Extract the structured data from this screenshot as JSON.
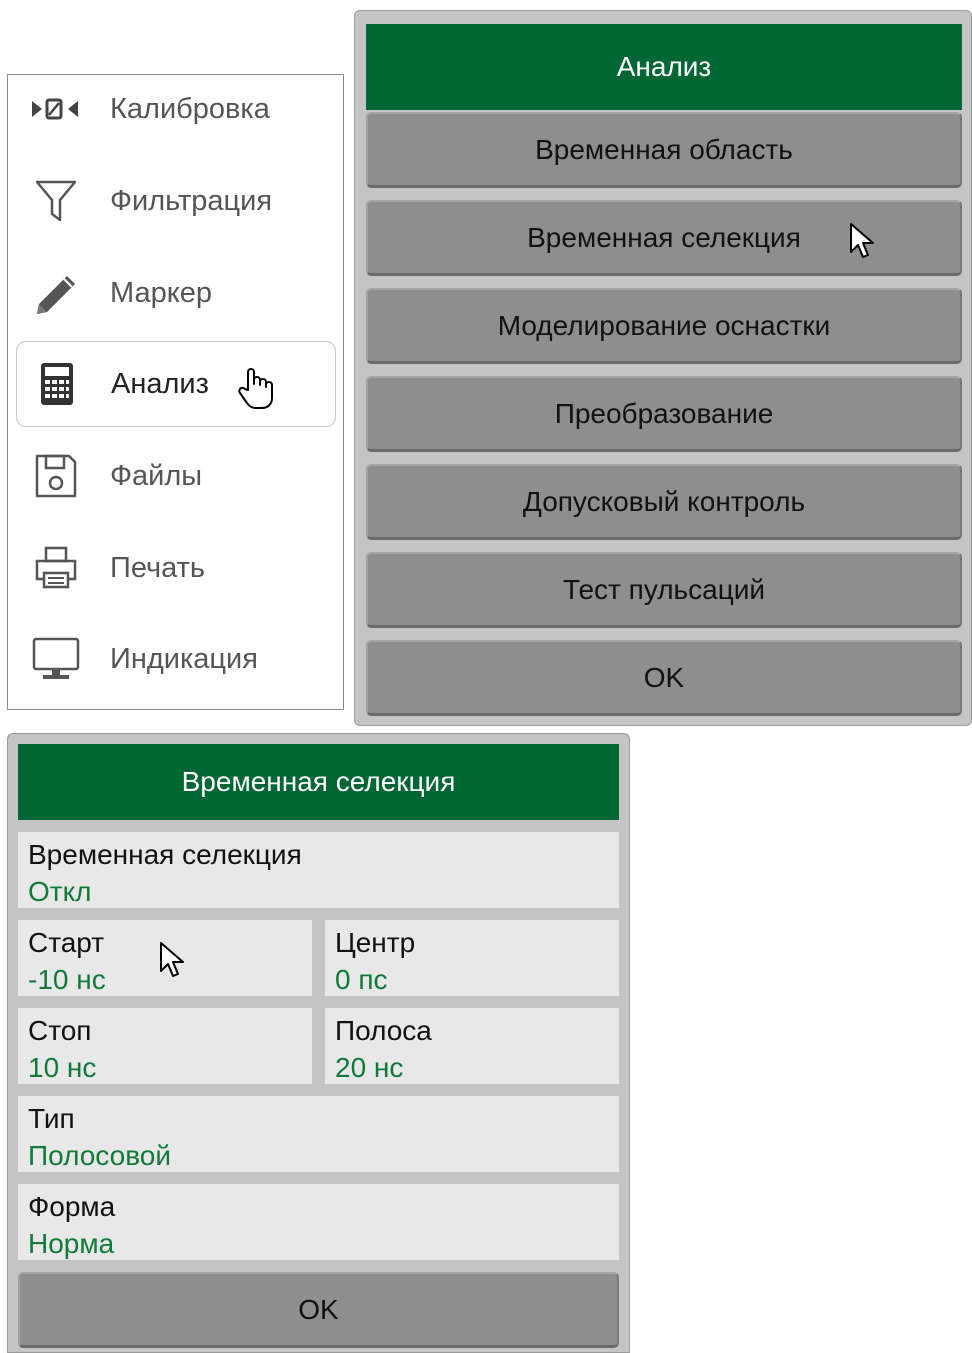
{
  "side_menu": {
    "items": [
      {
        "label": "Калибровка",
        "icon": "calibration-icon"
      },
      {
        "label": "Фильтрация",
        "icon": "filter-icon"
      },
      {
        "label": "Маркер",
        "icon": "pencil-icon"
      },
      {
        "label": "Анализ",
        "icon": "calculator-icon",
        "active": true
      },
      {
        "label": "Файлы",
        "icon": "floppy-disk-icon"
      },
      {
        "label": "Печать",
        "icon": "printer-icon"
      },
      {
        "label": "Индикация",
        "icon": "monitor-icon"
      }
    ],
    "calibration_glyph": "▶0◀"
  },
  "analysis_panel": {
    "title": "Анализ",
    "buttons": [
      "Временная область",
      "Временная селекция",
      "Моделирование оснастки",
      "Преобразование",
      "Допусковый контроль",
      "Тест пульсаций",
      "OK"
    ]
  },
  "gating_panel": {
    "title": "Временная селекция",
    "gating": {
      "label": "Временная селекция",
      "value": "Откл"
    },
    "start": {
      "label": "Старт",
      "value": "-10 нс"
    },
    "center": {
      "label": "Центр",
      "value": "0 пс"
    },
    "stop": {
      "label": "Стоп",
      "value": "10 нс"
    },
    "span": {
      "label": "Полоса",
      "value": "20 нс"
    },
    "type": {
      "label": "Тип",
      "value": "Полосовой"
    },
    "shape": {
      "label": "Форма",
      "value": "Норма"
    },
    "ok_label": "OK"
  },
  "colors": {
    "title_bar": "#006633",
    "value_text": "#117a3a",
    "button": "#8e8e8e",
    "panel_bg": "#c4c4c4",
    "field_bg": "#e8e8e8"
  }
}
